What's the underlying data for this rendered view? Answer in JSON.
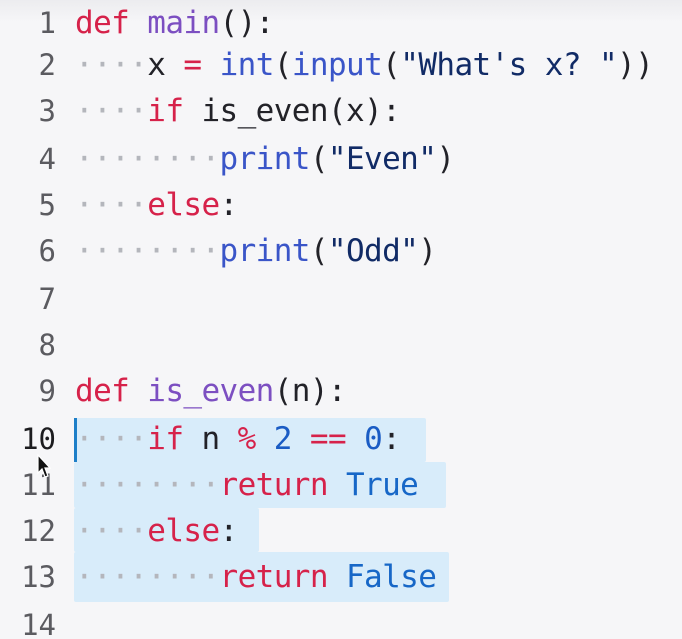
{
  "editor": {
    "language": "python",
    "active_line": "10",
    "lines": [
      {
        "num": "1",
        "indent": "",
        "tokens": [
          [
            "kw",
            "def"
          ],
          [
            "txt",
            " "
          ],
          [
            "fn",
            "main"
          ],
          [
            "punct",
            "():"
          ]
        ]
      },
      {
        "num": "2",
        "indent": "····",
        "tokens": [
          [
            "txt",
            "x "
          ],
          [
            "op",
            "="
          ],
          [
            "txt",
            " "
          ],
          [
            "bi",
            "int"
          ],
          [
            "punct",
            "("
          ],
          [
            "bi",
            "input"
          ],
          [
            "punct",
            "("
          ],
          [
            "str",
            "\"What's x? \""
          ],
          [
            "punct",
            "))"
          ]
        ]
      },
      {
        "num": "3",
        "indent": "····",
        "tokens": [
          [
            "kw",
            "if"
          ],
          [
            "txt",
            " is_even(x):"
          ]
        ]
      },
      {
        "num": "4",
        "indent": "········",
        "tokens": [
          [
            "bi",
            "print"
          ],
          [
            "punct",
            "("
          ],
          [
            "str",
            "\"Even\""
          ],
          [
            "punct",
            ")"
          ]
        ]
      },
      {
        "num": "5",
        "indent": "····",
        "tokens": [
          [
            "kw",
            "else"
          ],
          [
            "punct",
            ":"
          ]
        ]
      },
      {
        "num": "6",
        "indent": "········",
        "tokens": [
          [
            "bi",
            "print"
          ],
          [
            "punct",
            "("
          ],
          [
            "str",
            "\"Odd\""
          ],
          [
            "punct",
            ")"
          ]
        ]
      },
      {
        "num": "7",
        "indent": "",
        "tokens": []
      },
      {
        "num": "8",
        "indent": "",
        "tokens": []
      },
      {
        "num": "9",
        "indent": "",
        "tokens": [
          [
            "kw",
            "def"
          ],
          [
            "txt",
            " "
          ],
          [
            "fn",
            "is_even"
          ],
          [
            "punct",
            "(n):"
          ]
        ]
      },
      {
        "num": "10",
        "indent": "····",
        "tokens": [
          [
            "kw",
            "if"
          ],
          [
            "txt",
            " n "
          ],
          [
            "op",
            "%"
          ],
          [
            "txt",
            " "
          ],
          [
            "num",
            "2"
          ],
          [
            "txt",
            " "
          ],
          [
            "op",
            "=="
          ],
          [
            "txt",
            " "
          ],
          [
            "num",
            "0"
          ],
          [
            "punct",
            ":"
          ]
        ]
      },
      {
        "num": "11",
        "indent": "········",
        "tokens": [
          [
            "kw",
            "return"
          ],
          [
            "txt",
            " "
          ],
          [
            "const",
            "True"
          ]
        ]
      },
      {
        "num": "12",
        "indent": "····",
        "tokens": [
          [
            "kw",
            "else"
          ],
          [
            "punct",
            ":"
          ]
        ]
      },
      {
        "num": "13",
        "indent": "········",
        "tokens": [
          [
            "kw",
            "return"
          ],
          [
            "txt",
            " "
          ],
          [
            "const",
            "False"
          ]
        ]
      },
      {
        "num": "14",
        "indent": "",
        "tokens": []
      }
    ]
  },
  "colors": {
    "keyword": "#d6224a",
    "function_name": "#7c4fc1",
    "builtin": "#3a55c8",
    "string": "#112b66",
    "number": "#1a5cc4",
    "constant": "#1767c7",
    "selection": "#d8ecfa",
    "caret": "#1e7fc8",
    "whitespace_dots": "#b4b6bc"
  }
}
